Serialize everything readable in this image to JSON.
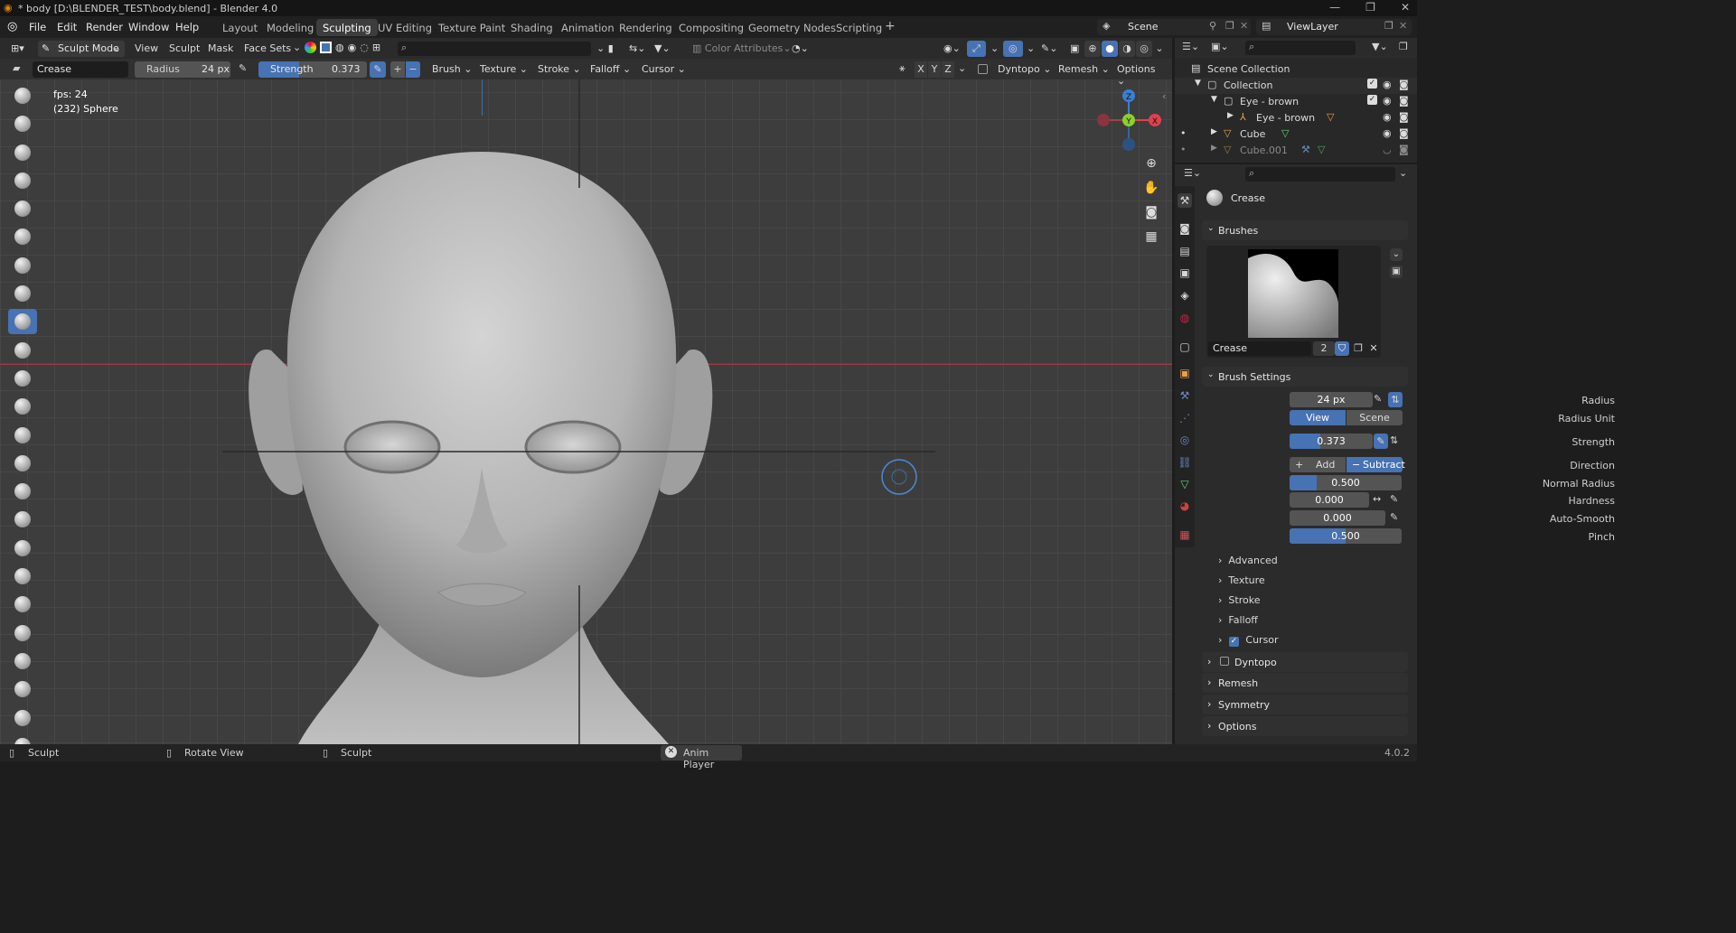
{
  "window": {
    "title": "* body [D:\\BLENDER_TEST\\body.blend] - Blender 4.0"
  },
  "menu": {
    "items": [
      "File",
      "Edit",
      "Render",
      "Window",
      "Help"
    ]
  },
  "workspaces": [
    "Layout",
    "Modeling",
    "Sculpting",
    "UV Editing",
    "Texture Paint",
    "Shading",
    "Animation",
    "Rendering",
    "Compositing",
    "Geometry Nodes",
    "Scripting"
  ],
  "workspace_active": "Sculpting",
  "scene": {
    "label": "Scene",
    "view_layer": "ViewLayer"
  },
  "viewport_header": {
    "mode": "Sculpt Mode",
    "menus": [
      "View",
      "Sculpt",
      "Mask",
      "Face Sets"
    ],
    "color_attributes": "Color Attributes"
  },
  "tool_header": {
    "brush_name": "Crease",
    "radius_label": "Radius",
    "radius_value": "24 px",
    "strength_label": "Strength",
    "strength_value": "0.373",
    "dropdowns": [
      "Brush",
      "Texture",
      "Stroke",
      "Falloff",
      "Cursor"
    ],
    "axes": [
      "X",
      "Y",
      "Z"
    ],
    "dyntopo": "Dyntopo",
    "remesh": "Remesh",
    "options": "Options"
  },
  "overlay": {
    "fps": "fps: 24",
    "object": "(232) Sphere"
  },
  "gizmo": {
    "z": "Z",
    "y": "Y",
    "x": "X"
  },
  "outliner": {
    "scene_collection": "Scene Collection",
    "rows": [
      {
        "name": "Collection",
        "indent": 0
      },
      {
        "name": "Eye - brown",
        "indent": 1
      },
      {
        "name": "Eye - brown",
        "indent": 2
      },
      {
        "name": "Cube",
        "indent": 1
      },
      {
        "name": "Cube.001",
        "indent": 1
      }
    ]
  },
  "properties": {
    "tool_name": "Crease",
    "brushes_panel": "Brushes",
    "brush_datablock": "Crease",
    "brush_users": "2",
    "brush_settings_panel": "Brush Settings",
    "radius": {
      "label": "Radius",
      "value": "24 px"
    },
    "radius_unit": {
      "label": "Radius Unit",
      "options": [
        "View",
        "Scene"
      ],
      "active": "View"
    },
    "strength": {
      "label": "Strength",
      "value": "0.373",
      "fill": 0.373
    },
    "direction": {
      "label": "Direction",
      "options": [
        "Add",
        "Subtract"
      ],
      "active": "Subtract"
    },
    "normal_radius": {
      "label": "Normal Radius",
      "value": "0.500",
      "fill": 0.5
    },
    "hardness": {
      "label": "Hardness",
      "value": "0.000",
      "fill": 0.0
    },
    "auto_smooth": {
      "label": "Auto-Smooth",
      "value": "0.000",
      "fill": 0.0
    },
    "pinch": {
      "label": "Pinch",
      "value": "0.500",
      "fill": 0.5
    },
    "subpanels": [
      "Advanced",
      "Texture",
      "Stroke",
      "Falloff",
      "Cursor"
    ],
    "panels": [
      "Dyntopo",
      "Remesh",
      "Symmetry",
      "Options"
    ]
  },
  "statusbar": {
    "left": "Sculpt",
    "middle": "Rotate View",
    "right": "Sculpt",
    "anim": "Anim Player",
    "version": "4.0.2"
  },
  "colors": {
    "accent": "#4772b3",
    "x_axis": "#e0414e",
    "y_axis": "#8bd02b",
    "z_axis": "#3a7fd6"
  }
}
